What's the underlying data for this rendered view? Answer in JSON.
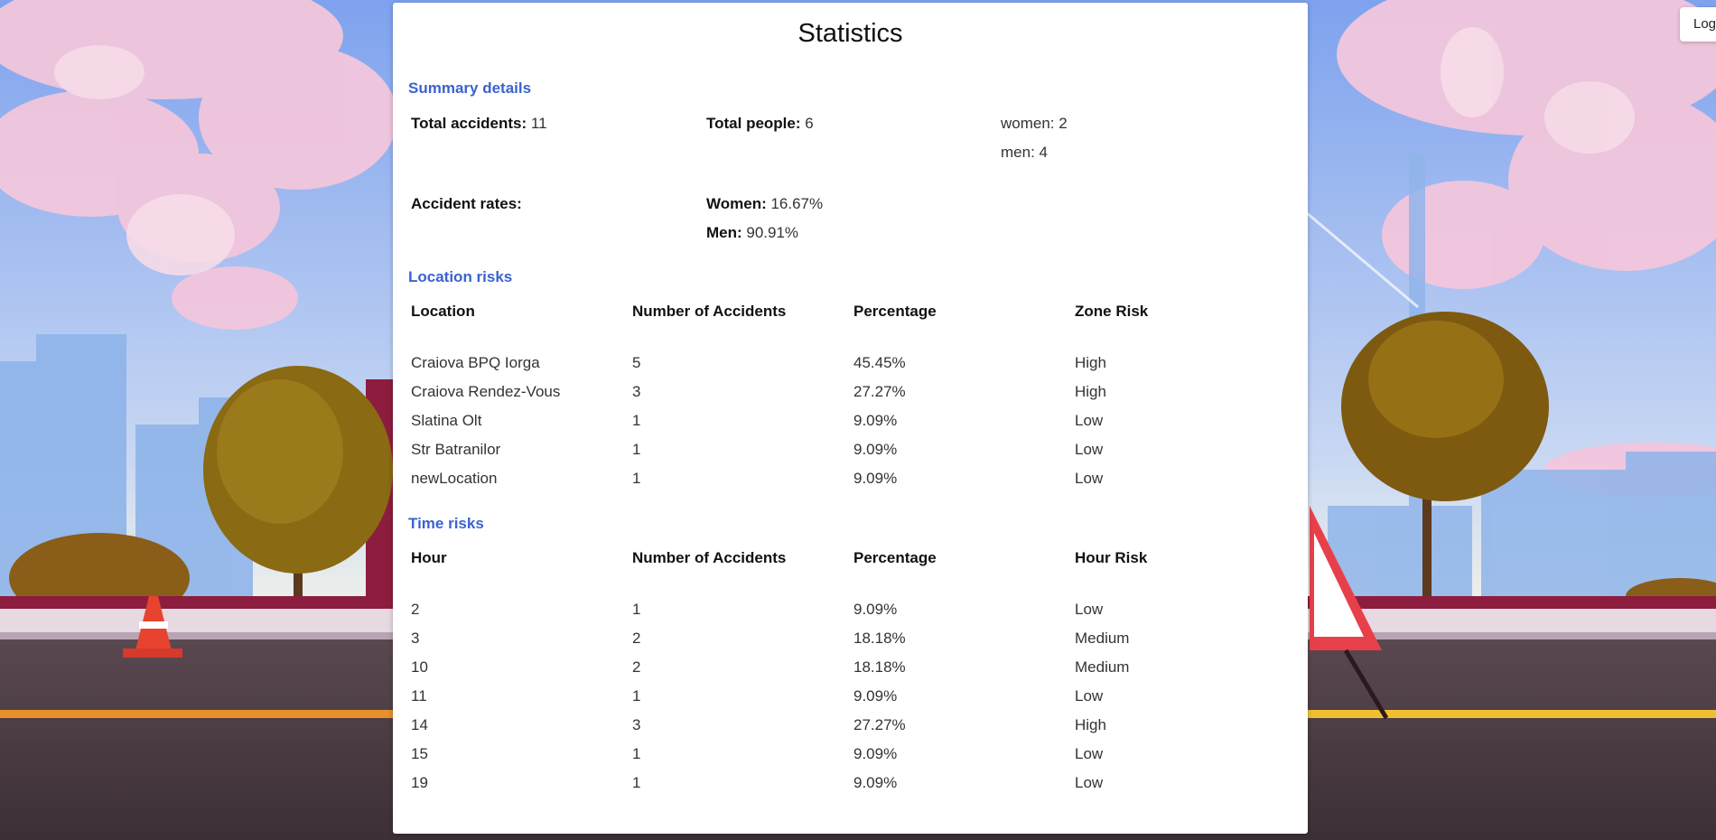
{
  "page": {
    "title": "Statistics",
    "login_label": "Logout"
  },
  "summary": {
    "title": "Summary details",
    "total_accidents_label": "Total accidents:",
    "total_accidents_value": " 11",
    "total_people_label": "Total people:",
    "total_people_value": " 6",
    "women_text": "women: 2",
    "men_text": "men: 4",
    "accident_rates_label": "Accident rates:",
    "women_rate_label": "Women:",
    "women_rate_value": " 16.67%",
    "men_rate_label": "Men:",
    "men_rate_value": " 90.91%"
  },
  "location_risks": {
    "title": "Location risks",
    "headers": [
      "Location",
      "Number of Accidents",
      "Percentage",
      "Zone Risk"
    ],
    "rows": [
      [
        "Craiova BPQ Iorga",
        "5",
        "45.45%",
        "High"
      ],
      [
        "Craiova Rendez-Vous",
        "3",
        "27.27%",
        "High"
      ],
      [
        "Slatina Olt",
        "1",
        "9.09%",
        "Low"
      ],
      [
        "Str Batranilor",
        "1",
        "9.09%",
        "Low"
      ],
      [
        "newLocation",
        "1",
        "9.09%",
        "Low"
      ]
    ]
  },
  "time_risks": {
    "title": "Time risks",
    "headers": [
      "Hour",
      "Number of Accidents",
      "Percentage",
      "Hour Risk"
    ],
    "rows": [
      [
        "2",
        "1",
        "9.09%",
        "Low"
      ],
      [
        "3",
        "2",
        "18.18%",
        "Medium"
      ],
      [
        "10",
        "2",
        "18.18%",
        "Medium"
      ],
      [
        "11",
        "1",
        "9.09%",
        "Low"
      ],
      [
        "14",
        "3",
        "27.27%",
        "High"
      ],
      [
        "15",
        "1",
        "9.09%",
        "Low"
      ],
      [
        "19",
        "1",
        "9.09%",
        "Low"
      ]
    ]
  },
  "colors": {
    "section_title": "#3a62d1",
    "card_bg": "#ffffff",
    "sky_top": "#8aa9ef",
    "road": "#4a3a42"
  }
}
